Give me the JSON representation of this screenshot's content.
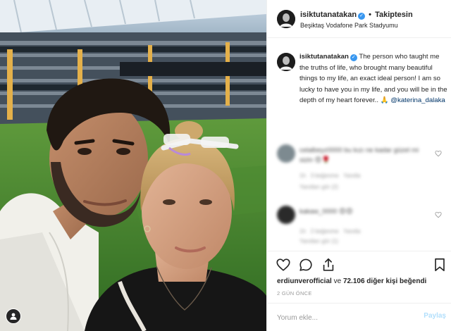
{
  "colors": {
    "accent": "#3897f0",
    "link": "#003569",
    "muted": "#999999",
    "border": "#efefef",
    "post_disabled": "#b2dffc"
  },
  "header": {
    "username": "isiktutanatakan",
    "separator": "•",
    "follow_state": "Takiptesin",
    "location": "Beşiktaş Vodafone Park Stadyumu",
    "verified_icon": "verified-badge-icon"
  },
  "caption": {
    "username": "isiktutanatakan",
    "text": "The person who taught me the truths of life, who brought many beautiful things to my life, an exact ideal person! I am so lucky to have you in my life, and you will be in the depth of my heart forever.. ",
    "emoji": "🙏",
    "mention": "@katerina_dalaka"
  },
  "comments": [
    {
      "text": "celalbeyz0000 bu kızı ne kadar güzel mi sizin 😍🌹",
      "time": "1h",
      "likes_label": "3 beğenme",
      "reply_label": "Yanıtla",
      "view_replies": "Yanıtları gör (2)"
    },
    {
      "text": "kakaw_0000 😍😍",
      "time": "1h",
      "likes_label": "2 beğenme",
      "reply_label": "Yanıtla",
      "view_replies": "Yanıtları gör (1)"
    }
  ],
  "actions": {
    "like_icon": "heart-icon",
    "comment_icon": "comment-icon",
    "share_icon": "share-icon",
    "save_icon": "bookmark-icon"
  },
  "likes": {
    "first_user": "erdiunverofficial",
    "connector": " ve ",
    "count": "72.106",
    "suffix": " diğer kişi beğendi"
  },
  "timestamp": "2 GÜN ÖNCE",
  "comment_box": {
    "placeholder": "Yorum ekle...",
    "post_label": "Paylaş"
  }
}
